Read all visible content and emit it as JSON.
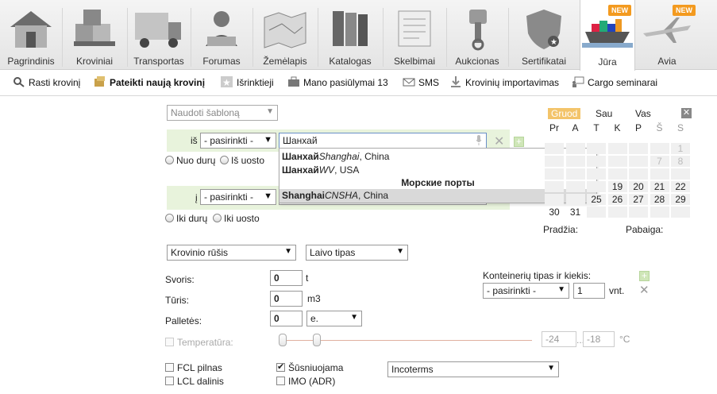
{
  "nav": {
    "tabs": [
      {
        "label": "Pagrindinis",
        "icon": "house-icon"
      },
      {
        "label": "Kroviniai",
        "icon": "boxes-icon"
      },
      {
        "label": "Transportas",
        "icon": "truck-icon"
      },
      {
        "label": "Forumas",
        "icon": "forum-person-icon"
      },
      {
        "label": "Žemėlapis",
        "icon": "map-icon"
      },
      {
        "label": "Katalogas",
        "icon": "books-icon"
      },
      {
        "label": "Skelbimai",
        "icon": "newspaper-icon"
      },
      {
        "label": "Aukcionas",
        "icon": "piston-icon"
      },
      {
        "label": "Sertifikatai",
        "icon": "shield-icon"
      },
      {
        "label": "Jūra",
        "icon": "ship-icon",
        "badge": "NEW"
      },
      {
        "label": "Avia",
        "icon": "airplane-icon",
        "badge": "NEW"
      }
    ]
  },
  "subbar": {
    "items": [
      {
        "label": "Rasti krovinį",
        "icon": "search-icon"
      },
      {
        "label": "Pateikti naują krovinį",
        "icon": "submit-cargo-icon"
      },
      {
        "label": "Išrinktieji",
        "icon": "star-icon"
      },
      {
        "label": "Mano pasiūlymai 13",
        "icon": "briefcase-icon"
      },
      {
        "label": "SMS",
        "icon": "envelope-icon"
      },
      {
        "label": "Krovinių importavimas",
        "icon": "import-icon"
      },
      {
        "label": "Cargo seminarai",
        "icon": "seminar-icon"
      }
    ]
  },
  "form": {
    "template_select": "Naudoti šabloną",
    "from_label": "iš",
    "from_country": "- pasirinkti -",
    "from_city": "Шанхай",
    "from_door": "Nuo durų",
    "from_port": "Iš uosto",
    "to_label": "į",
    "to_country": "- pasirinkti -",
    "to_door": "Iki durų",
    "to_port": "Iki uosto",
    "cargo_type": "Krovinio rūšis",
    "ship_type": "Laivo tipas",
    "weight_label": "Svoris:",
    "weight_value": "0",
    "weight_unit": "t",
    "volume_label": "Tūris:",
    "volume_value": "0",
    "volume_unit": "m3",
    "pallets_label": "Palletės:",
    "pallets_value": "0",
    "pallets_unit": "e.",
    "temperature_label": "Temperatūra:",
    "temp_min": "-24",
    "temp_sep": "...",
    "temp_max": "-18",
    "temp_unit": "°C",
    "container_label": "Konteinerių tipas ir kiekis:",
    "container_type": "- pasirinkti -",
    "container_qty": "1",
    "container_unit": "vnt.",
    "fcl": "FCL pilnas",
    "lcl": "LCL dalinis",
    "stackable": "Šūsniuojama",
    "imo": "IMO (ADR)",
    "incoterms": "Incoterms"
  },
  "dropdown": {
    "items": [
      {
        "bold": "Шанхай",
        "italic": "Shanghai",
        "rest": ", China"
      },
      {
        "bold": "Шанхай",
        "italic": "WV",
        "rest": ", USA"
      }
    ],
    "section": "Морские порты",
    "highlight": {
      "bold": "Shanghai",
      "italic": "CNSHA",
      "rest": ", China"
    }
  },
  "calendar": {
    "months": [
      "Gruod",
      "Sau",
      "Vas"
    ],
    "weekdays": [
      "Pr",
      "A",
      "T",
      "K",
      "P",
      "Š",
      "S"
    ],
    "visible_days": [
      [
        "",
        "",
        "",
        "",
        "",
        "",
        "1"
      ],
      [
        "",
        "",
        "",
        "",
        "",
        "7",
        "8"
      ],
      [
        "",
        "",
        "",
        "",
        "",
        "",
        ""
      ],
      [
        "",
        "",
        "",
        "19",
        "20",
        "21",
        "22"
      ],
      [
        "",
        "",
        "25",
        "26",
        "27",
        "28",
        "29"
      ],
      [
        "30",
        "31",
        "",
        "",
        "",
        "",
        ""
      ]
    ],
    "start_label": "Pradžia:",
    "end_label": "Pabaiga:"
  }
}
